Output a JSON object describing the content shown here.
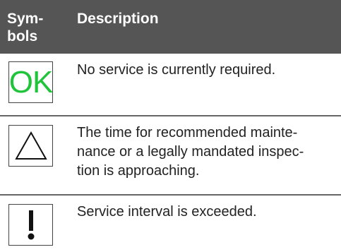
{
  "header": {
    "symbols_label": "Sym-\nbols",
    "description_label": "Description"
  },
  "rows": [
    {
      "icon": "ok-icon",
      "symbol_text": "OK",
      "symbol_color": "#1fc43a",
      "description": "No service is currently required."
    },
    {
      "icon": "triangle-warning-icon",
      "description": "The time for recommended mainte-\nnance or a legally mandated inspec-\ntion is approaching."
    },
    {
      "icon": "exclamation-icon",
      "description": "Service interval is exceeded."
    }
  ],
  "colors": {
    "header_bg": "#555555",
    "header_text": "#ffffff",
    "ok_green": "#1fc43a",
    "divider": "#666666"
  }
}
